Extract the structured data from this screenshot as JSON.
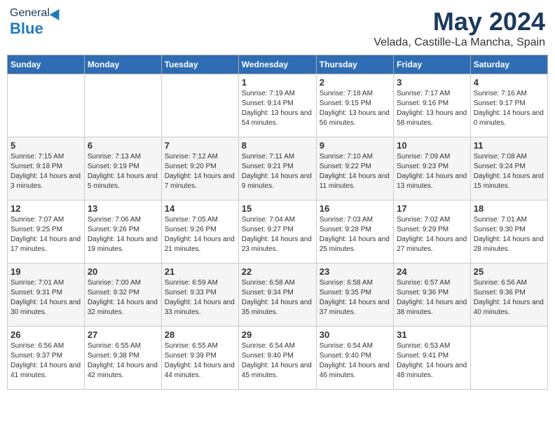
{
  "header": {
    "logo_general": "General",
    "logo_blue": "Blue",
    "month": "May 2024",
    "location": "Velada, Castille-La Mancha, Spain"
  },
  "weekdays": [
    "Sunday",
    "Monday",
    "Tuesday",
    "Wednesday",
    "Thursday",
    "Friday",
    "Saturday"
  ],
  "weeks": [
    [
      {
        "day": "",
        "info": ""
      },
      {
        "day": "",
        "info": ""
      },
      {
        "day": "",
        "info": ""
      },
      {
        "day": "1",
        "info": "Sunrise: 7:19 AM\nSunset: 9:14 PM\nDaylight: 13 hours and 54 minutes."
      },
      {
        "day": "2",
        "info": "Sunrise: 7:18 AM\nSunset: 9:15 PM\nDaylight: 13 hours and 56 minutes."
      },
      {
        "day": "3",
        "info": "Sunrise: 7:17 AM\nSunset: 9:16 PM\nDaylight: 13 hours and 58 minutes."
      },
      {
        "day": "4",
        "info": "Sunrise: 7:16 AM\nSunset: 9:17 PM\nDaylight: 14 hours and 0 minutes."
      }
    ],
    [
      {
        "day": "5",
        "info": "Sunrise: 7:15 AM\nSunset: 9:18 PM\nDaylight: 14 hours and 3 minutes."
      },
      {
        "day": "6",
        "info": "Sunrise: 7:13 AM\nSunset: 9:19 PM\nDaylight: 14 hours and 5 minutes."
      },
      {
        "day": "7",
        "info": "Sunrise: 7:12 AM\nSunset: 9:20 PM\nDaylight: 14 hours and 7 minutes."
      },
      {
        "day": "8",
        "info": "Sunrise: 7:11 AM\nSunset: 9:21 PM\nDaylight: 14 hours and 9 minutes."
      },
      {
        "day": "9",
        "info": "Sunrise: 7:10 AM\nSunset: 9:22 PM\nDaylight: 14 hours and 11 minutes."
      },
      {
        "day": "10",
        "info": "Sunrise: 7:09 AM\nSunset: 9:23 PM\nDaylight: 14 hours and 13 minutes."
      },
      {
        "day": "11",
        "info": "Sunrise: 7:08 AM\nSunset: 9:24 PM\nDaylight: 14 hours and 15 minutes."
      }
    ],
    [
      {
        "day": "12",
        "info": "Sunrise: 7:07 AM\nSunset: 9:25 PM\nDaylight: 14 hours and 17 minutes."
      },
      {
        "day": "13",
        "info": "Sunrise: 7:06 AM\nSunset: 9:26 PM\nDaylight: 14 hours and 19 minutes."
      },
      {
        "day": "14",
        "info": "Sunrise: 7:05 AM\nSunset: 9:26 PM\nDaylight: 14 hours and 21 minutes."
      },
      {
        "day": "15",
        "info": "Sunrise: 7:04 AM\nSunset: 9:27 PM\nDaylight: 14 hours and 23 minutes."
      },
      {
        "day": "16",
        "info": "Sunrise: 7:03 AM\nSunset: 9:28 PM\nDaylight: 14 hours and 25 minutes."
      },
      {
        "day": "17",
        "info": "Sunrise: 7:02 AM\nSunset: 9:29 PM\nDaylight: 14 hours and 27 minutes."
      },
      {
        "day": "18",
        "info": "Sunrise: 7:01 AM\nSunset: 9:30 PM\nDaylight: 14 hours and 28 minutes."
      }
    ],
    [
      {
        "day": "19",
        "info": "Sunrise: 7:01 AM\nSunset: 9:31 PM\nDaylight: 14 hours and 30 minutes."
      },
      {
        "day": "20",
        "info": "Sunrise: 7:00 AM\nSunset: 9:32 PM\nDaylight: 14 hours and 32 minutes."
      },
      {
        "day": "21",
        "info": "Sunrise: 6:59 AM\nSunset: 9:33 PM\nDaylight: 14 hours and 33 minutes."
      },
      {
        "day": "22",
        "info": "Sunrise: 6:58 AM\nSunset: 9:34 PM\nDaylight: 14 hours and 35 minutes."
      },
      {
        "day": "23",
        "info": "Sunrise: 6:58 AM\nSunset: 9:35 PM\nDaylight: 14 hours and 37 minutes."
      },
      {
        "day": "24",
        "info": "Sunrise: 6:57 AM\nSunset: 9:36 PM\nDaylight: 14 hours and 38 minutes."
      },
      {
        "day": "25",
        "info": "Sunrise: 6:56 AM\nSunset: 9:36 PM\nDaylight: 14 hours and 40 minutes."
      }
    ],
    [
      {
        "day": "26",
        "info": "Sunrise: 6:56 AM\nSunset: 9:37 PM\nDaylight: 14 hours and 41 minutes."
      },
      {
        "day": "27",
        "info": "Sunrise: 6:55 AM\nSunset: 9:38 PM\nDaylight: 14 hours and 42 minutes."
      },
      {
        "day": "28",
        "info": "Sunrise: 6:55 AM\nSunset: 9:39 PM\nDaylight: 14 hours and 44 minutes."
      },
      {
        "day": "29",
        "info": "Sunrise: 6:54 AM\nSunset: 9:40 PM\nDaylight: 14 hours and 45 minutes."
      },
      {
        "day": "30",
        "info": "Sunrise: 6:54 AM\nSunset: 9:40 PM\nDaylight: 14 hours and 46 minutes."
      },
      {
        "day": "31",
        "info": "Sunrise: 6:53 AM\nSunset: 9:41 PM\nDaylight: 14 hours and 48 minutes."
      },
      {
        "day": "",
        "info": ""
      }
    ]
  ]
}
